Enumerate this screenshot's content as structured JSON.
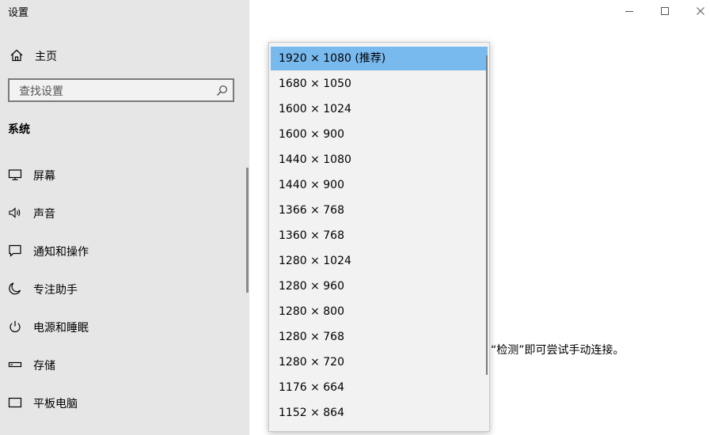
{
  "window": {
    "title": "设置",
    "minimize_icon": "minimize-icon",
    "maximize_icon": "maximize-icon",
    "close_icon": "close-icon"
  },
  "sidebar": {
    "home_label": "主页",
    "home_icon": "home-icon",
    "search_placeholder": "查找设置",
    "search_value": "",
    "search_icon": "search-icon",
    "section_title": "系统",
    "items": [
      {
        "label": "屏幕",
        "icon": "monitor-icon"
      },
      {
        "label": "声音",
        "icon": "speaker-icon"
      },
      {
        "label": "通知和操作",
        "icon": "notification-icon"
      },
      {
        "label": "专注助手",
        "icon": "moon-icon"
      },
      {
        "label": "电源和睡眠",
        "icon": "power-icon"
      },
      {
        "label": "存储",
        "icon": "storage-icon"
      },
      {
        "label": "平板电脑",
        "icon": "tablet-icon"
      }
    ]
  },
  "content": {
    "partial_text": "“检测”即可尝试手动连接。"
  },
  "resolution_dropdown": {
    "selected": "1920 × 1080 (推荐)",
    "options": [
      "1920 × 1080 (推荐)",
      "1680 × 1050",
      "1600 × 1024",
      "1600 × 900",
      "1440 × 1080",
      "1440 × 900",
      "1366 × 768",
      "1360 × 768",
      "1280 × 1024",
      "1280 × 960",
      "1280 × 800",
      "1280 × 768",
      "1280 × 720",
      "1176 × 664",
      "1152 × 864"
    ]
  },
  "colors": {
    "sidebar_bg": "#e6e6e6",
    "selected_option": "#78b9ee",
    "dropdown_bg": "#f2f2f2"
  }
}
